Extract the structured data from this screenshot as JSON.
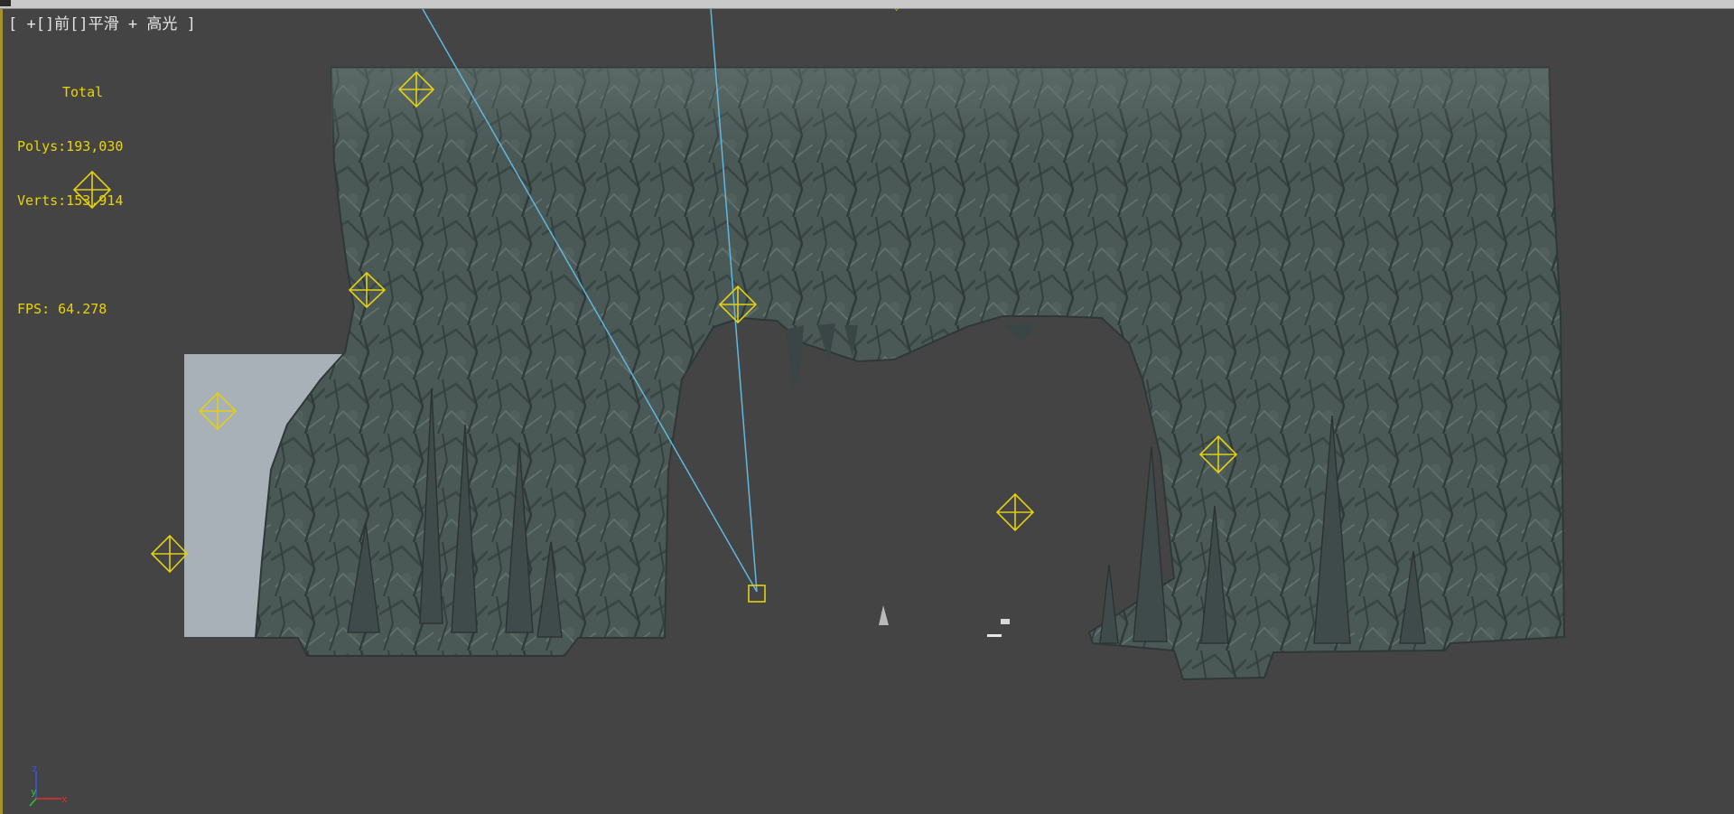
{
  "viewport": {
    "label": "[ +[]前[]平滑 + 高光 ]",
    "stats": {
      "total_label": "Total",
      "polys": "Polys:193,030",
      "verts": "Verts:153,914",
      "fps": "FPS: 64.278"
    },
    "axis_labels": {
      "z": "z",
      "y": "y",
      "x": "x"
    },
    "colors": {
      "background": "#444444",
      "stats_text": "#e9d400",
      "helper_yellow": "#e2cf16",
      "camera_line": "#5fb8e0",
      "rock_dark": "#3c4a48",
      "rock_light": "#5b6a66",
      "backdrop_plane": "#a8b1b8"
    },
    "icons": [
      "light-helper-icon",
      "camera-target-icon",
      "axis-gizmo-icon"
    ]
  }
}
